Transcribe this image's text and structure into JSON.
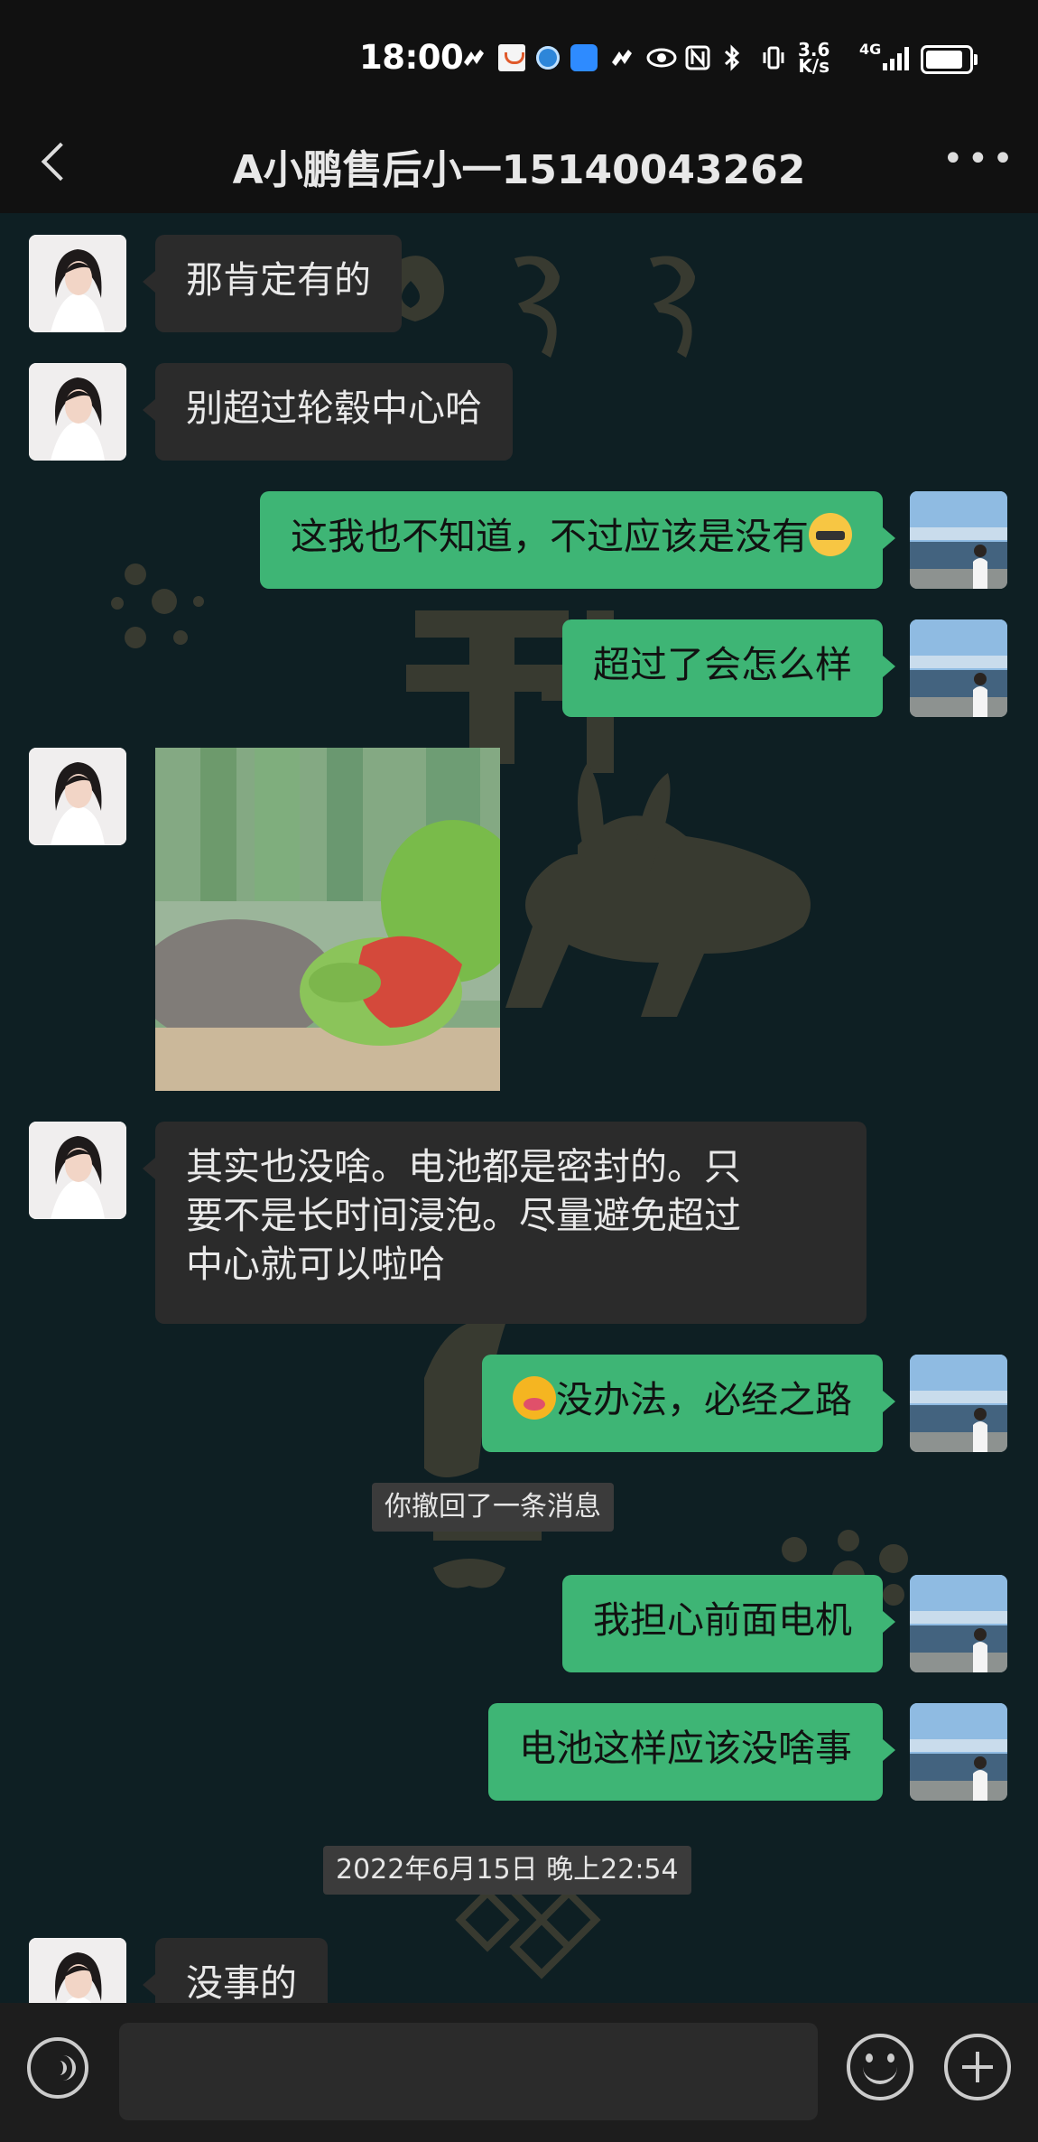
{
  "status_bar": {
    "time": "18:00",
    "network_speed": "3.6\nK/s",
    "network_type": "4G",
    "icons": [
      "sync-icon",
      "app-icon",
      "app-icon",
      "app-icon",
      "sync-icon",
      "eye-icon",
      "nfc-icon",
      "bluetooth-icon",
      "vibrate-icon",
      "signal-icon",
      "battery-icon"
    ]
  },
  "header": {
    "title": "A小鹏售后小一15140043262",
    "back_icon": "chevron-left-icon",
    "more_icon": "more-dots-icon"
  },
  "messages": [
    {
      "side": "in",
      "text": "那肯定有的"
    },
    {
      "side": "in",
      "text": "别超过轮毂中心哈"
    },
    {
      "side": "out",
      "text": "这我也不知道，不过应该是没有",
      "emoji_after": "cat-sunglasses-emoji"
    },
    {
      "side": "out",
      "text": "超过了会怎么样"
    },
    {
      "side": "in",
      "type": "sticker",
      "sticker": "frog-plush-hugging-heart"
    },
    {
      "side": "in",
      "text": "其实也没啥。电池都是密封的。只\n要不是长时间浸泡。尽量避免超过\n中心就可以啦哈"
    },
    {
      "side": "out",
      "text": "没办法，必经之路",
      "emoji_before": "drooling-face-emoji"
    },
    {
      "type": "system",
      "text": "你撤回了一条消息"
    },
    {
      "side": "out",
      "text": "我担心前面电机"
    },
    {
      "side": "out",
      "text": "电池这样应该没啥事"
    },
    {
      "type": "timestamp",
      "text": "2022年6月15日 晚上22:54"
    },
    {
      "side": "in",
      "text": "没事的"
    }
  ],
  "input_bar": {
    "voice_icon": "voice-icon",
    "input_value": "",
    "emoji_icon": "emoji-icon",
    "plus_icon": "plus-icon"
  },
  "colors": {
    "outgoing_bubble": "#3eb575",
    "incoming_bubble": "#2b2b2b",
    "chat_background": "#0e1f23"
  }
}
